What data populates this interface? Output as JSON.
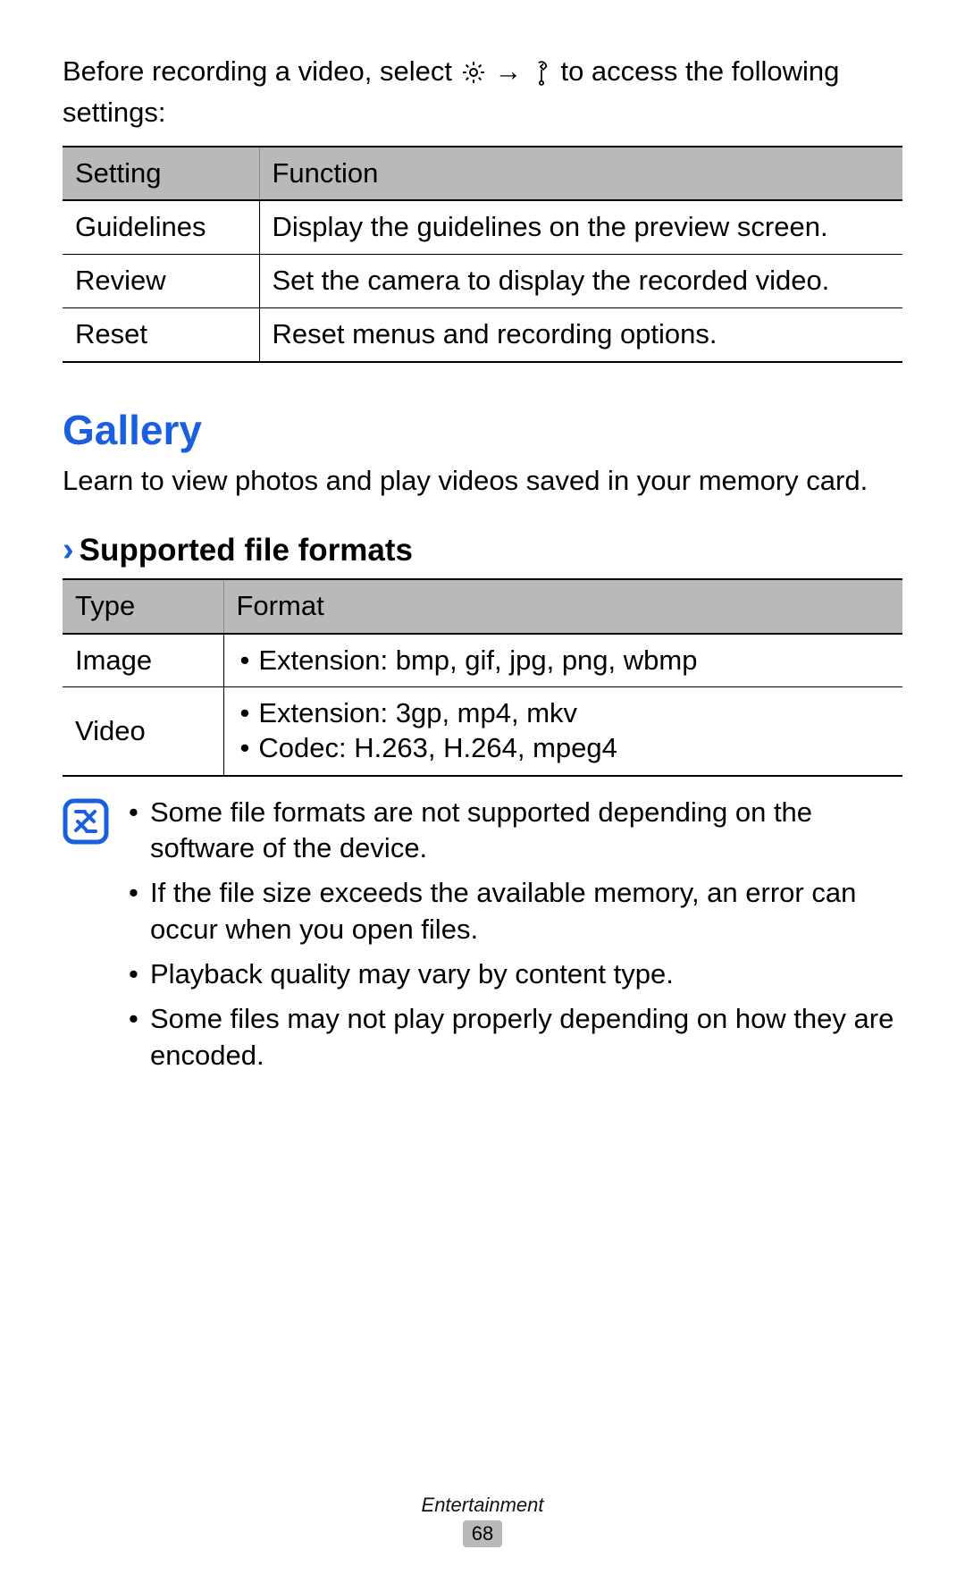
{
  "intro": {
    "pre": "Before recording a video, select ",
    "arrow": " → ",
    "post": " to access the following settings:",
    "icon1_name": "gear-icon",
    "icon2_name": "wrench-icon"
  },
  "settings_table": {
    "headers": {
      "col1": "Setting",
      "col2": "Function"
    },
    "rows": [
      {
        "setting": "Guidelines",
        "function": "Display the guidelines on the preview screen."
      },
      {
        "setting": "Review",
        "function": "Set the camera to display the recorded video."
      },
      {
        "setting": "Reset",
        "function": "Reset menus and recording options."
      }
    ]
  },
  "gallery": {
    "title": "Gallery",
    "lead": "Learn to view photos and play videos saved in your memory card."
  },
  "supported": {
    "chevron": "›",
    "heading": "Supported file formats",
    "headers": {
      "col1": "Type",
      "col2": "Format"
    },
    "rows": [
      {
        "type": "Image",
        "lines": [
          "Extension: bmp, gif, jpg, png, wbmp"
        ]
      },
      {
        "type": "Video",
        "lines": [
          "Extension: 3gp, mp4, mkv",
          "Codec: H.263, H.264, mpeg4"
        ]
      }
    ]
  },
  "notes": [
    "Some file formats are not supported depending on the software of the device.",
    "If the file size exceeds the available memory, an error can occur when you open files.",
    "Playback quality may vary by content type.",
    "Some files may not play properly depending on how they are encoded."
  ],
  "footer": {
    "category": "Entertainment",
    "page": "68"
  }
}
